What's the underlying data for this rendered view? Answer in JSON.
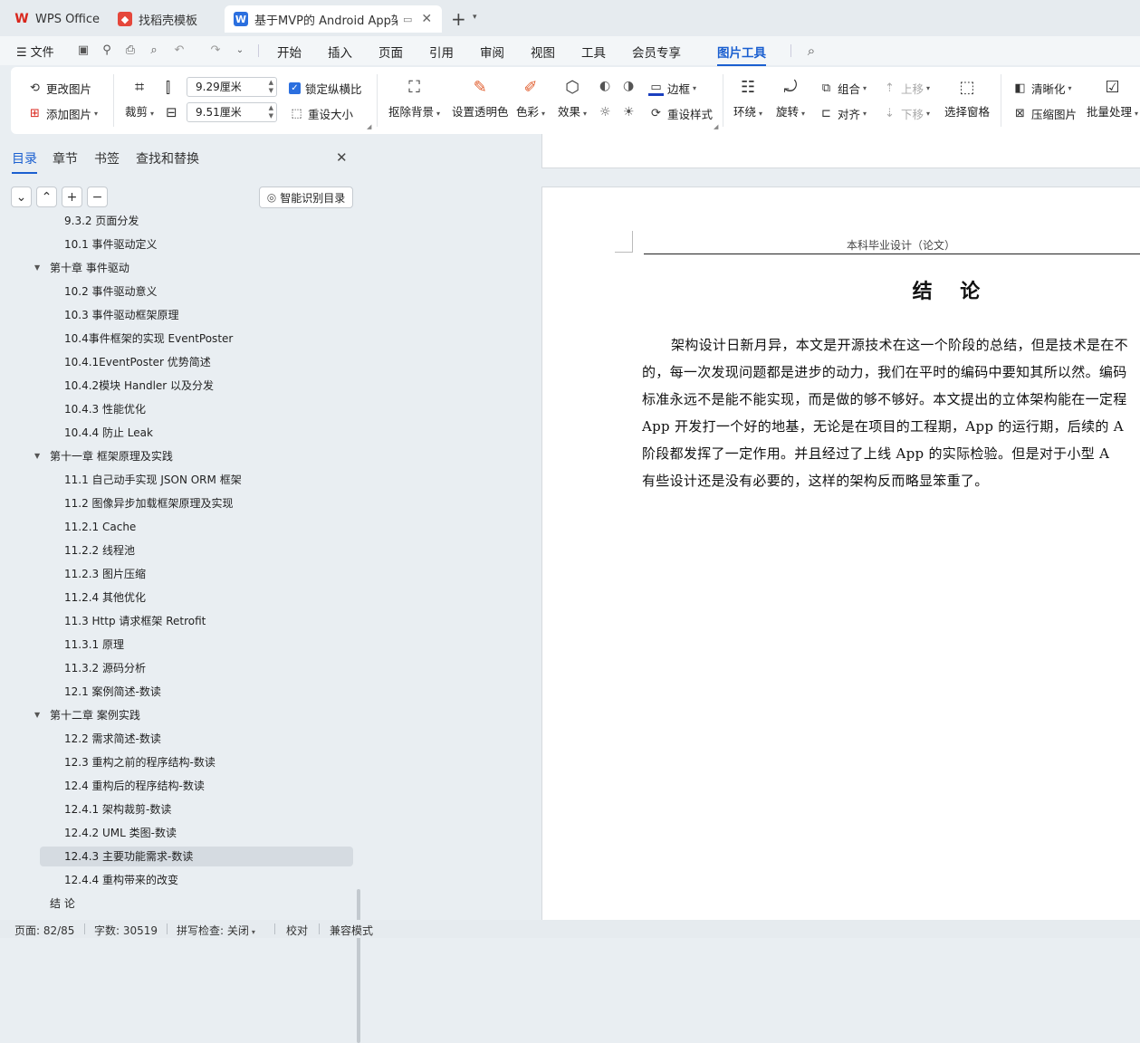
{
  "tabs": [
    {
      "label": "WPS Office",
      "icon": "wps-logo-icon"
    },
    {
      "label": "找稻壳模板",
      "icon": "docer-icon"
    },
    {
      "label": "基于MVP的 Android App架构",
      "icon": "word-doc-icon"
    }
  ],
  "menu": {
    "file": "文件",
    "items": [
      "开始",
      "插入",
      "页面",
      "引用",
      "审阅",
      "视图",
      "工具",
      "会员专享",
      "图片工具"
    ],
    "active": "图片工具"
  },
  "ribbon": {
    "change_pic": "更改图片",
    "add_pic": "添加图片",
    "crop": "裁剪",
    "width": "9.29厘米",
    "height": "9.51厘米",
    "lock_ratio": "锁定纵横比",
    "reset_size": "重设大小",
    "remove_bg": "抠除背景",
    "set_transparent": "设置透明色",
    "color": "色彩",
    "effect": "效果",
    "border": "边框",
    "reset_style": "重设样式",
    "wrap": "环绕",
    "rotate": "旋转",
    "group": "组合",
    "align": "对齐",
    "move_up": "上移",
    "move_down": "下移",
    "select_pane": "选择窗格",
    "sharpen": "清晰化",
    "compress": "压缩图片",
    "batch": "批量处理"
  },
  "nav": {
    "tabs": [
      "目录",
      "章节",
      "书签",
      "查找和替换"
    ],
    "smart_toc": "智能识别目录",
    "items": [
      {
        "label": "9.3.2 页面分发",
        "level": 2
      },
      {
        "label": "10.1 事件驱动定义",
        "level": 2
      },
      {
        "label": "第十章 事件驱动",
        "level": 1
      },
      {
        "label": "10.2 事件驱动意义",
        "level": 2
      },
      {
        "label": "10.3 事件驱动框架原理",
        "level": 2
      },
      {
        "label": "10.4事件框架的实现 EventPoster",
        "level": 2
      },
      {
        "label": "10.4.1EventPoster 优势简述",
        "level": 2
      },
      {
        "label": "10.4.2模块 Handler 以及分发",
        "level": 2
      },
      {
        "label": "10.4.3 性能优化",
        "level": 2
      },
      {
        "label": "10.4.4  防止 Leak",
        "level": 2
      },
      {
        "label": "第十一章 框架原理及实践",
        "level": 1
      },
      {
        "label": "11.1  自己动手实现 JSON ORM  框架",
        "level": 2
      },
      {
        "label": "11.2  图像异步加载框架原理及实现",
        "level": 2
      },
      {
        "label": "11.2.1 Cache",
        "level": 2
      },
      {
        "label": "11.2.2  线程池",
        "level": 2
      },
      {
        "label": "11.2.3  图片压缩",
        "level": 2
      },
      {
        "label": "11.2.4  其他优化",
        "level": 2
      },
      {
        "label": "11.3 Http  请求框架 Retrofit",
        "level": 2
      },
      {
        "label": "11.3.1   原理",
        "level": 2
      },
      {
        "label": "11.3.2  源码分析",
        "level": 2
      },
      {
        "label": "12.1 案例简述-数读",
        "level": 2
      },
      {
        "label": "第十二章 案例实践",
        "level": 1
      },
      {
        "label": "12.2 需求简述-数读",
        "level": 2
      },
      {
        "label": "12.3 重构之前的程序结构-数读",
        "level": 2
      },
      {
        "label": "12.4 重构后的程序结构-数读",
        "level": 2
      },
      {
        "label": "12.4.1 架构裁剪-数读",
        "level": 2
      },
      {
        "label": "12.4.2 UML 类图-数读",
        "level": 2
      },
      {
        "label": "12.4.3 主要功能需求-数读",
        "level": 2,
        "selected": true
      },
      {
        "label": "12.4.4 重构带来的改变",
        "level": 2
      },
      {
        "label": "结 论",
        "level": 1
      }
    ]
  },
  "document": {
    "header": "本科毕业设计（论文）",
    "title": "结    论",
    "lines": [
      "架构设计日新月异，本文是开源技术在这一个阶段的总结，但是技术是在不",
      "的，每一次发现问题都是进步的动力，我们在平时的编码中要知其所以然。编码",
      "标准永远不是能不能实现，而是做的够不够好。本文提出的立体架构能在一定程",
      "App 开发打一个好的地基，无论是在项目的工程期，App 的运行期，后续的  A",
      "阶段都发挥了一定作用。并且经过了上线  App 的实际检验。但是对于小型  A",
      "有些设计还是没有必要的，这样的架构反而略显笨重了。"
    ]
  },
  "status": {
    "page": "页面: 82/85",
    "words": "字数: 30519",
    "spell": "拼写检查: 关闭",
    "proof": "校对",
    "compat": "兼容模式"
  },
  "colors": {
    "accent": "#1a5fd0",
    "wps_red": "#d9261c",
    "word_blue": "#2b6fdf"
  }
}
